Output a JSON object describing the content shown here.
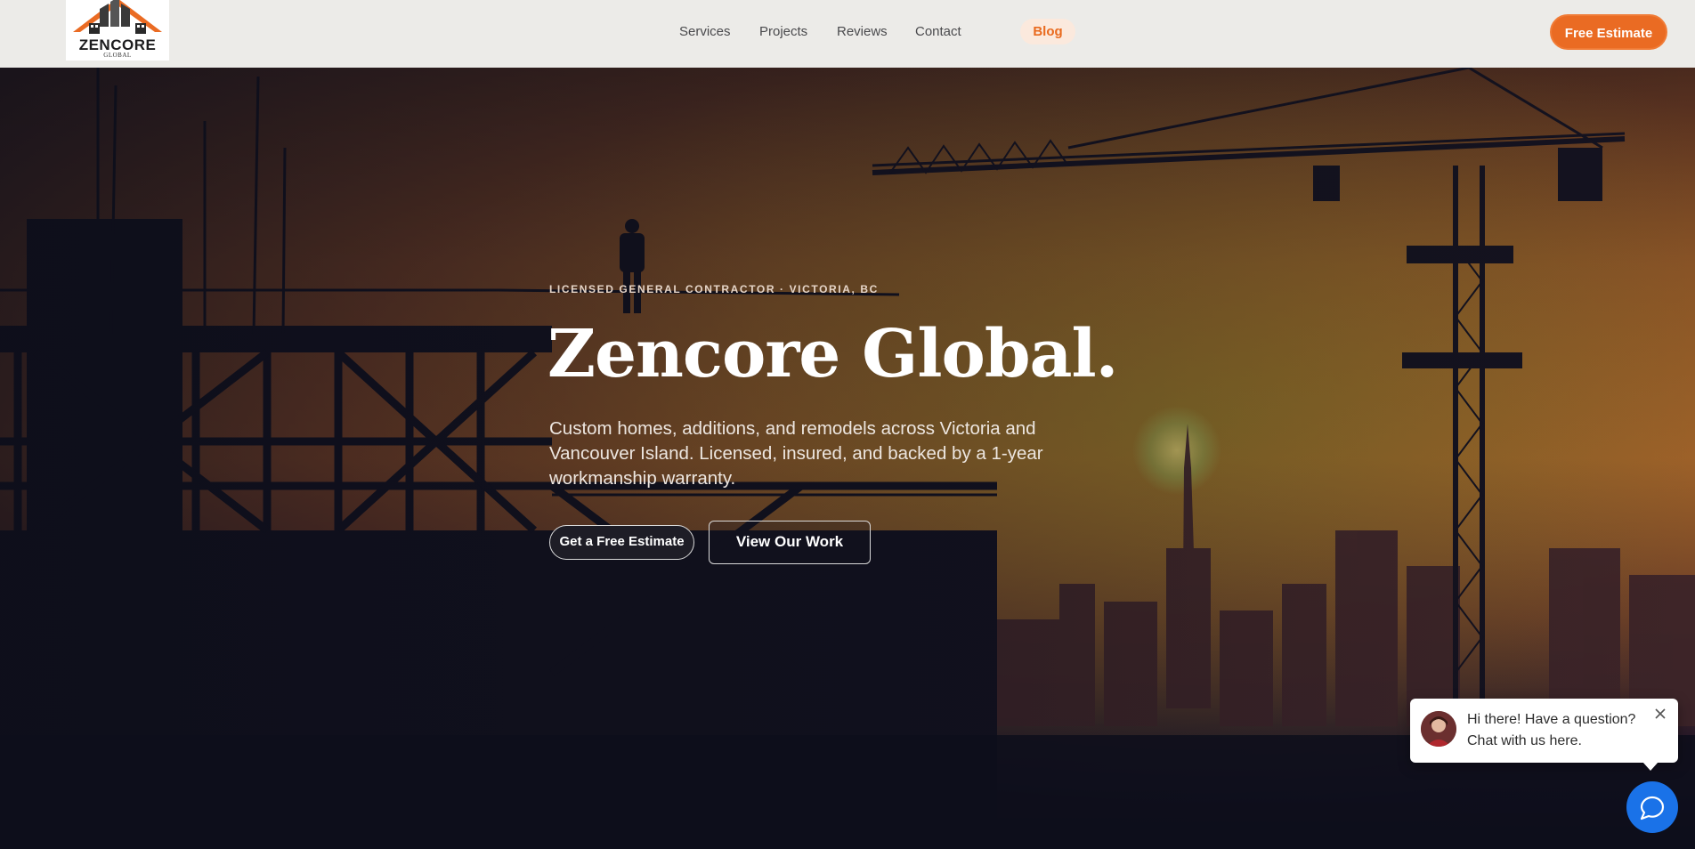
{
  "brand": {
    "logo_word": "ZENCORE",
    "logo_sub": "GLOBAL",
    "accent_color": "#ea6b23"
  },
  "nav": {
    "items": [
      {
        "label": "Services"
      },
      {
        "label": "Projects"
      },
      {
        "label": "Reviews"
      },
      {
        "label": "Contact"
      }
    ],
    "blog_label": "Blog",
    "cta_label": "Free Estimate"
  },
  "hero": {
    "kicker": "LICENSED GENERAL CONTRACTOR · VICTORIA, BC",
    "headline": "Zencore Global.",
    "subtext": "Custom homes, additions, and remodels across Victoria and Vancouver Island. Licensed, insured, and backed by a 1-year workmanship warranty.",
    "primary_button": "Get a Free Estimate",
    "secondary_button": "View Our Work",
    "background_image": "construction-site-sunset-silhouette"
  },
  "chat": {
    "message": "Hi there! Have a question? Chat with us here.",
    "close_icon": "close-icon",
    "launcher_icon": "chat-icon",
    "launcher_color": "#1a72e8"
  }
}
